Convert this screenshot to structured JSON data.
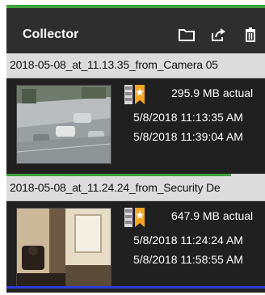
{
  "panel": {
    "title": "Collector",
    "icons": [
      "folder-icon",
      "share-icon",
      "trash-icon"
    ]
  },
  "colors": {
    "accent_green": "#3fa33b",
    "accent_blue": "#2a3bd6",
    "badge_orange": "#f5a623",
    "header_bg": "#2e2e2e",
    "title_bar_bg": "#dcdcdc"
  },
  "items": [
    {
      "title": "2018-05-08_at_11.13.35_from_Camera 05",
      "size": "295.9 MB actual",
      "start": "5/8/2018 11:13:35 AM",
      "end": "5/8/2018 11:39:04 AM",
      "progress": 0.87
    },
    {
      "title": "2018-05-08_at_11.24.24_from_Security De",
      "size": "647.9 MB actual",
      "start": "5/8/2018 11:24:24 AM",
      "end": "5/8/2018 11:58:55 AM"
    }
  ]
}
